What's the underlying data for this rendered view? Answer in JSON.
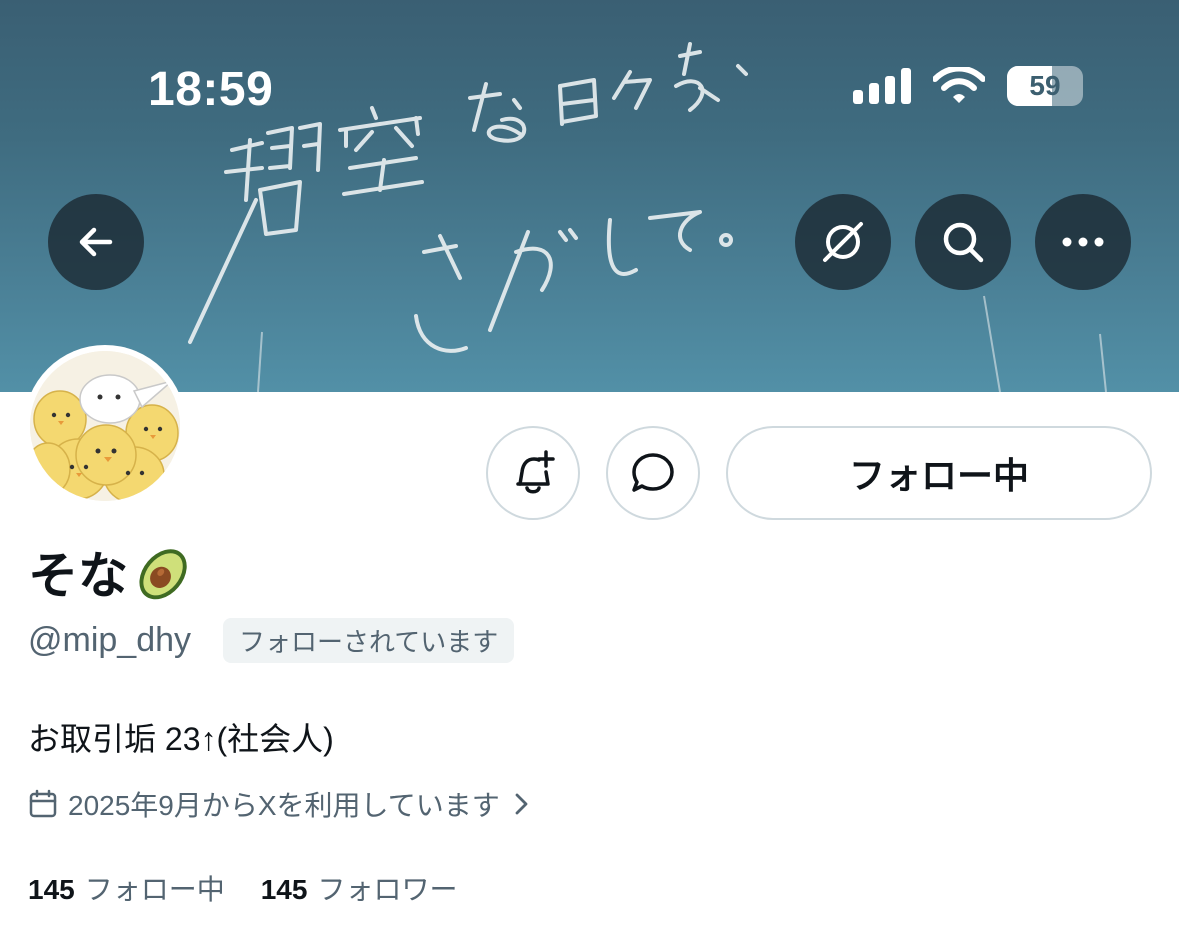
{
  "status_bar": {
    "time": "18:59",
    "battery_level": "59",
    "battery_fraction": 0.59,
    "icons": [
      "signal-icon",
      "wifi-icon",
      "battery-icon"
    ]
  },
  "banner": {
    "handwritten_text": "碧空な日々を、さがして。"
  },
  "header_buttons": [
    "back-arrow-icon",
    "grok-icon",
    "search-icon",
    "more-icon"
  ],
  "profile": {
    "display_name": "そな",
    "display_name_emoji": "avocado",
    "handle": "@mip_dhy",
    "follows_you_badge": "フォローされています",
    "bio": "お取引垢 23↑(社会人)",
    "joined": "2025年9月からXを利用しています"
  },
  "actions": {
    "follow_label": "フォロー中"
  },
  "stats": {
    "following_count": "145",
    "following_label": "フォロー中",
    "followers_count": "145",
    "followers_label": "フォロワー"
  },
  "colors": {
    "text_primary": "#0f1419",
    "text_secondary": "#536471",
    "border": "#cfd9de",
    "banner": "#3f6c80"
  }
}
